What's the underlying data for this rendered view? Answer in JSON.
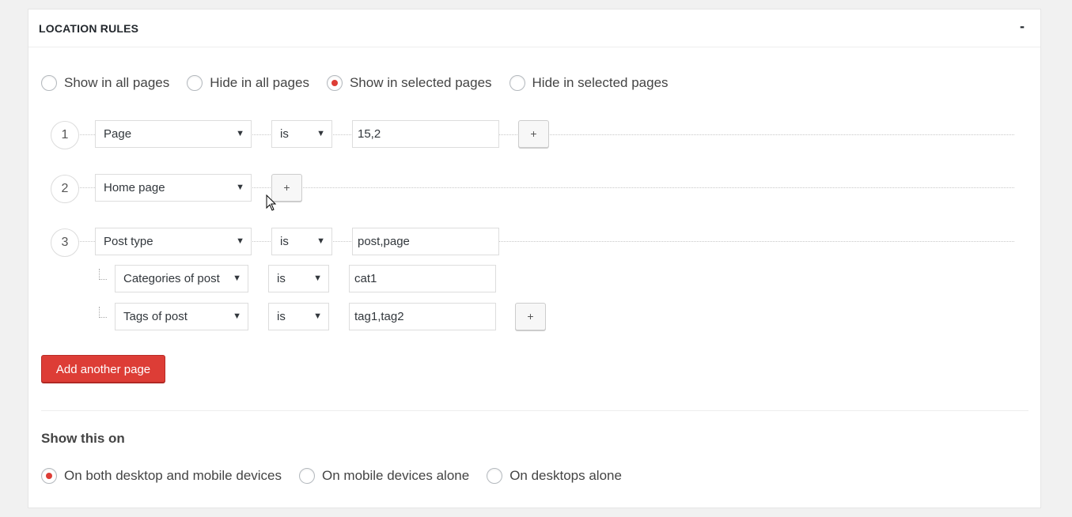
{
  "header": {
    "title": "LOCATION RULES",
    "collapse_label": "-"
  },
  "visibility": {
    "options": [
      {
        "label": "Show in all pages",
        "checked": false
      },
      {
        "label": "Hide in all pages",
        "checked": false
      },
      {
        "label": "Show in selected pages",
        "checked": true
      },
      {
        "label": "Hide in selected pages",
        "checked": false
      }
    ]
  },
  "rules": [
    {
      "number": "1",
      "type": "Page",
      "operator": "is",
      "value": "15,2",
      "add_label": "+"
    },
    {
      "number": "2",
      "type": "Home page",
      "add_label": "+"
    },
    {
      "number": "3",
      "type": "Post type",
      "operator": "is",
      "value": "post,page",
      "children": [
        {
          "type": "Categories of post",
          "operator": "is",
          "value": "cat1"
        },
        {
          "type": "Tags of post",
          "operator": "is",
          "value": "tag1,tag2",
          "add_label": "+"
        }
      ]
    }
  ],
  "add_page_label": "Add another page",
  "devices": {
    "title": "Show this on",
    "options": [
      {
        "label": "On both desktop and mobile devices",
        "checked": true
      },
      {
        "label": "On mobile devices alone",
        "checked": false
      },
      {
        "label": "On desktops alone",
        "checked": false
      }
    ]
  },
  "colors": {
    "accent": "#dd3d36",
    "panel_bg": "#ffffff",
    "page_bg": "#f1f1f1"
  }
}
